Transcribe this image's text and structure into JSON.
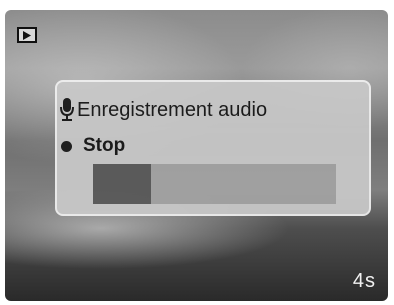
{
  "screen": {
    "mode_icon": "playback-mode-icon"
  },
  "dialog": {
    "title": "Enregistrement audio",
    "title_icon": "microphone-icon",
    "status_icon": "record-dot-icon",
    "status_label": "Stop",
    "progress": 0.24
  },
  "timer": {
    "remaining": "4s"
  },
  "colors": {
    "progress_fill": "#585858",
    "progress_track": "#a3a3a3",
    "dialog_bg": "#c9c9c9"
  }
}
